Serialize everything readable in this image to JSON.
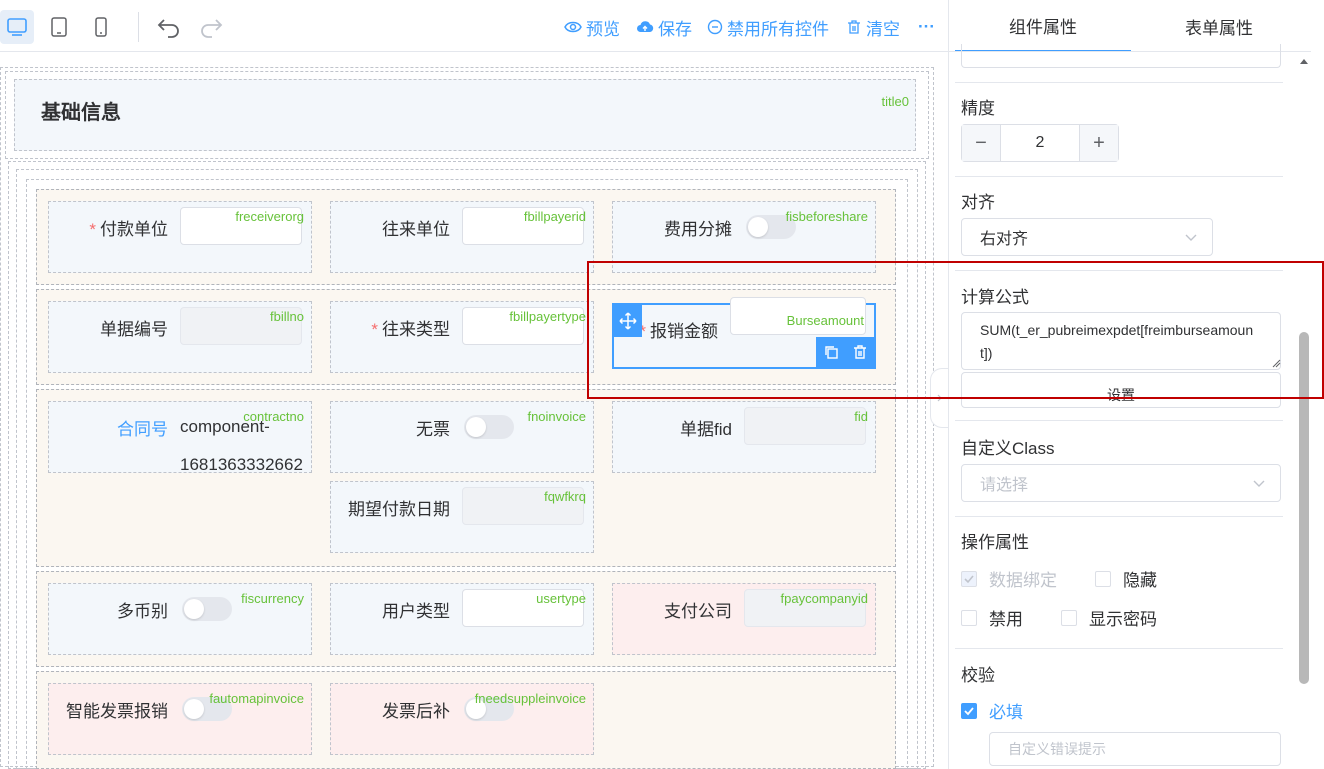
{
  "toolbar": {
    "devices": [
      "desktop-icon",
      "tablet-icon",
      "mobile-icon"
    ],
    "actions": [
      {
        "icon": "eye-icon",
        "label": "预览"
      },
      {
        "icon": "cloud-upload-icon",
        "label": "保存"
      },
      {
        "icon": "minus-circle-icon",
        "label": "禁用所有控件"
      },
      {
        "icon": "trash-icon",
        "label": "清空"
      },
      {
        "icon": "more-icon",
        "label": "···"
      }
    ]
  },
  "canvas": {
    "section_title": "基础信息",
    "section_code": "title0",
    "fields": [
      {
        "label": "付款单位",
        "required": true,
        "code": "freceiverorg",
        "control": "input"
      },
      {
        "label": "往来单位",
        "required": false,
        "code": "fbillpayerid",
        "control": "input"
      },
      {
        "label": "费用分摊",
        "required": false,
        "code": "fisbeforeshare",
        "control": "switch"
      },
      {
        "label": "单据编号",
        "required": false,
        "code": "fbillno",
        "control": "input-disabled"
      },
      {
        "label": "往来类型",
        "required": true,
        "code": "fbillpayertype",
        "control": "input"
      },
      {
        "label": "报销金额",
        "required": true,
        "code": "Burseamount",
        "control": "input",
        "selected": true
      },
      {
        "label": "合同号",
        "required": false,
        "code": "contractno",
        "control": "text",
        "value_line1": "component-",
        "value_line2": "1681363332662"
      },
      {
        "label": "无票",
        "required": false,
        "code": "fnoinvoice",
        "control": "switch"
      },
      {
        "label": "单据fid",
        "required": false,
        "code": "fid",
        "control": "input-disabled"
      },
      {
        "label": "期望付款日期",
        "required": false,
        "code": "fqwfkrq",
        "control": "input-disabled"
      },
      {
        "label": "多币别",
        "required": false,
        "code": "fiscurrency",
        "control": "switch"
      },
      {
        "label": "用户类型",
        "required": false,
        "code": "usertype",
        "control": "input"
      },
      {
        "label": "支付公司",
        "required": false,
        "code": "fpaycompanyid",
        "control": "input-disabled"
      },
      {
        "label": "智能发票报销",
        "required": false,
        "code": "fautomapinvoice",
        "control": "switch"
      },
      {
        "label": "发票后补",
        "required": false,
        "code": "fneedsuppleinvoice",
        "control": "switch"
      }
    ]
  },
  "panel": {
    "tabs": [
      "组件属性",
      "表单属性"
    ],
    "active_tab": 0,
    "precision_label": "精度",
    "precision_value": "2",
    "minus": "−",
    "plus": "+",
    "align_label": "对齐",
    "align_value": "右对齐",
    "formula_label": "计算公式",
    "formula_value": "SUM(t_er_pubreimexpdet[freimburseamount])",
    "set_button": "设置",
    "class_label": "自定义Class",
    "class_placeholder": "请选择",
    "ops_label": "操作属性",
    "ops": [
      {
        "label": "数据绑定",
        "checked": true,
        "disabled": true
      },
      {
        "label": "隐藏",
        "checked": false,
        "disabled": false
      },
      {
        "label": "禁用",
        "checked": false,
        "disabled": false
      },
      {
        "label": "显示密码",
        "checked": false,
        "disabled": false
      }
    ],
    "validation_label": "校验",
    "required_label": "必填",
    "required_checked": true,
    "error_placeholder": "自定义错误提示"
  },
  "colors": {
    "accent": "#409eff",
    "code": "#67c23a",
    "required": "#f56c6c",
    "highlight": "#c00000"
  }
}
